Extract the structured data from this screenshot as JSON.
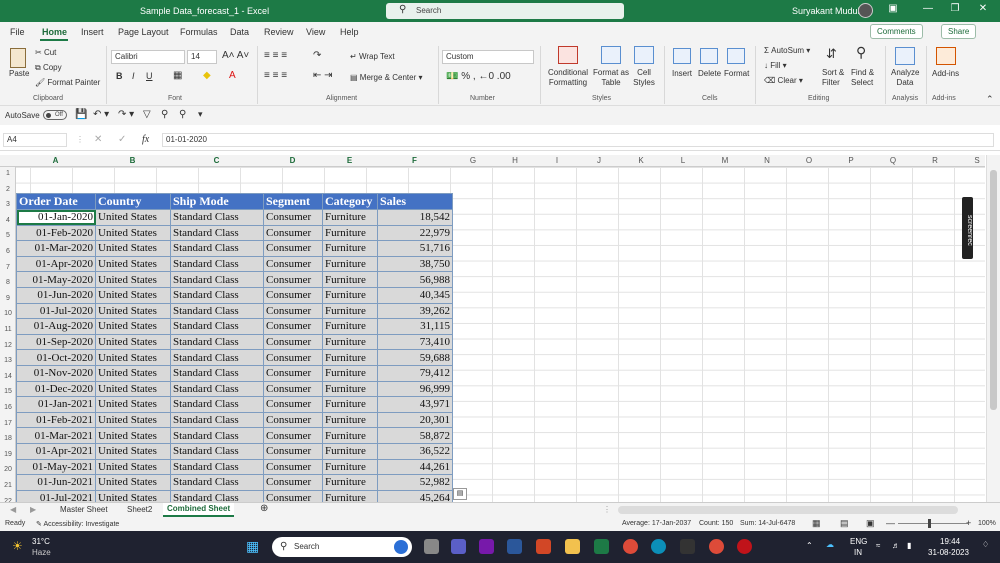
{
  "titlebar": {
    "doc_title": "Sample Data_forecast_1  -  Excel",
    "search_placeholder": "Search",
    "user": "Suryakant Muduli"
  },
  "menu": {
    "tabs": [
      "File",
      "Home",
      "Insert",
      "Page Layout",
      "Formulas",
      "Data",
      "Review",
      "View",
      "Help"
    ],
    "comments": "Comments",
    "share": "Share"
  },
  "ribbon": {
    "paste": "Paste",
    "cut": "Cut",
    "copy": "Copy",
    "format_painter": "Format Painter",
    "clipboard": "Clipboard",
    "font_name": "Calibri",
    "font_size": "14",
    "font_group": "Font",
    "wrap_text": "Wrap Text",
    "merge_center": "Merge & Center",
    "alignment": "Alignment",
    "number_format": "Custom",
    "number": "Number",
    "conditional": "Conditional Formatting",
    "format_table": "Format as Table",
    "cell_styles": "Cell Styles",
    "styles": "Styles",
    "insert": "Insert",
    "delete": "Delete",
    "format": "Format",
    "cells": "Cells",
    "autosum": "AutoSum",
    "fill": "Fill",
    "clear": "Clear",
    "sort_filter": "Sort & Filter",
    "find_select": "Find & Select",
    "editing": "Editing",
    "analyze": "Analyze Data",
    "analysis": "Analysis",
    "addins": "Add-ins",
    "addins_group": "Add-ins"
  },
  "qat": {
    "autosave": "AutoSave",
    "toggle": "Off"
  },
  "formula_bar": {
    "name_box": "A4",
    "fx": "fx",
    "content": "01-01-2020"
  },
  "columns": [
    "A",
    "B",
    "C",
    "D",
    "E",
    "F",
    "G",
    "H",
    "I",
    "J",
    "K",
    "L",
    "M",
    "N",
    "O",
    "P",
    "Q",
    "R",
    "S"
  ],
  "rows": [
    "1",
    "2",
    "3",
    "4",
    "5",
    "6",
    "7",
    "8",
    "9",
    "10",
    "11",
    "12",
    "13",
    "14",
    "15",
    "16",
    "17",
    "18",
    "19",
    "20",
    "21",
    "22"
  ],
  "table": {
    "headers": [
      "Order Date",
      "Country",
      "Ship Mode",
      "Segment",
      "Category",
      "Sales"
    ],
    "data": [
      [
        "01-Jan-2020",
        "United States",
        "Standard Class",
        "Consumer",
        "Furniture",
        "18,542"
      ],
      [
        "01-Feb-2020",
        "United States",
        "Standard Class",
        "Consumer",
        "Furniture",
        "22,979"
      ],
      [
        "01-Mar-2020",
        "United States",
        "Standard Class",
        "Consumer",
        "Furniture",
        "51,716"
      ],
      [
        "01-Apr-2020",
        "United States",
        "Standard Class",
        "Consumer",
        "Furniture",
        "38,750"
      ],
      [
        "01-May-2020",
        "United States",
        "Standard Class",
        "Consumer",
        "Furniture",
        "56,988"
      ],
      [
        "01-Jun-2020",
        "United States",
        "Standard Class",
        "Consumer",
        "Furniture",
        "40,345"
      ],
      [
        "01-Jul-2020",
        "United States",
        "Standard Class",
        "Consumer",
        "Furniture",
        "39,262"
      ],
      [
        "01-Aug-2020",
        "United States",
        "Standard Class",
        "Consumer",
        "Furniture",
        "31,115"
      ],
      [
        "01-Sep-2020",
        "United States",
        "Standard Class",
        "Consumer",
        "Furniture",
        "73,410"
      ],
      [
        "01-Oct-2020",
        "United States",
        "Standard Class",
        "Consumer",
        "Furniture",
        "59,688"
      ],
      [
        "01-Nov-2020",
        "United States",
        "Standard Class",
        "Consumer",
        "Furniture",
        "79,412"
      ],
      [
        "01-Dec-2020",
        "United States",
        "Standard Class",
        "Consumer",
        "Furniture",
        "96,999"
      ],
      [
        "01-Jan-2021",
        "United States",
        "Standard Class",
        "Consumer",
        "Furniture",
        "43,971"
      ],
      [
        "01-Feb-2021",
        "United States",
        "Standard Class",
        "Consumer",
        "Furniture",
        "20,301"
      ],
      [
        "01-Mar-2021",
        "United States",
        "Standard Class",
        "Consumer",
        "Furniture",
        "58,872"
      ],
      [
        "01-Apr-2021",
        "United States",
        "Standard Class",
        "Consumer",
        "Furniture",
        "36,522"
      ],
      [
        "01-May-2021",
        "United States",
        "Standard Class",
        "Consumer",
        "Furniture",
        "44,261"
      ],
      [
        "01-Jun-2021",
        "United States",
        "Standard Class",
        "Consumer",
        "Furniture",
        "52,982"
      ],
      [
        "01-Jul-2021",
        "United States",
        "Standard Class",
        "Consumer",
        "Furniture",
        "45,264"
      ]
    ]
  },
  "sheets": [
    "Master Sheet",
    "Sheet2",
    "Combined Sheet"
  ],
  "status": {
    "ready": "Ready",
    "accessibility": "Accessibility: Investigate",
    "average": "Average: 17-Jan-2037",
    "count": "Count: 150",
    "sum": "Sum: 14-Jul-6478",
    "zoom": "100%"
  },
  "taskbar": {
    "temp": "31°C",
    "weather": "Haze",
    "search": "Search",
    "lang1": "ENG",
    "lang2": "IN",
    "time": "19:44",
    "date": "31-08-2023"
  },
  "screenrec_label": "screenrec"
}
